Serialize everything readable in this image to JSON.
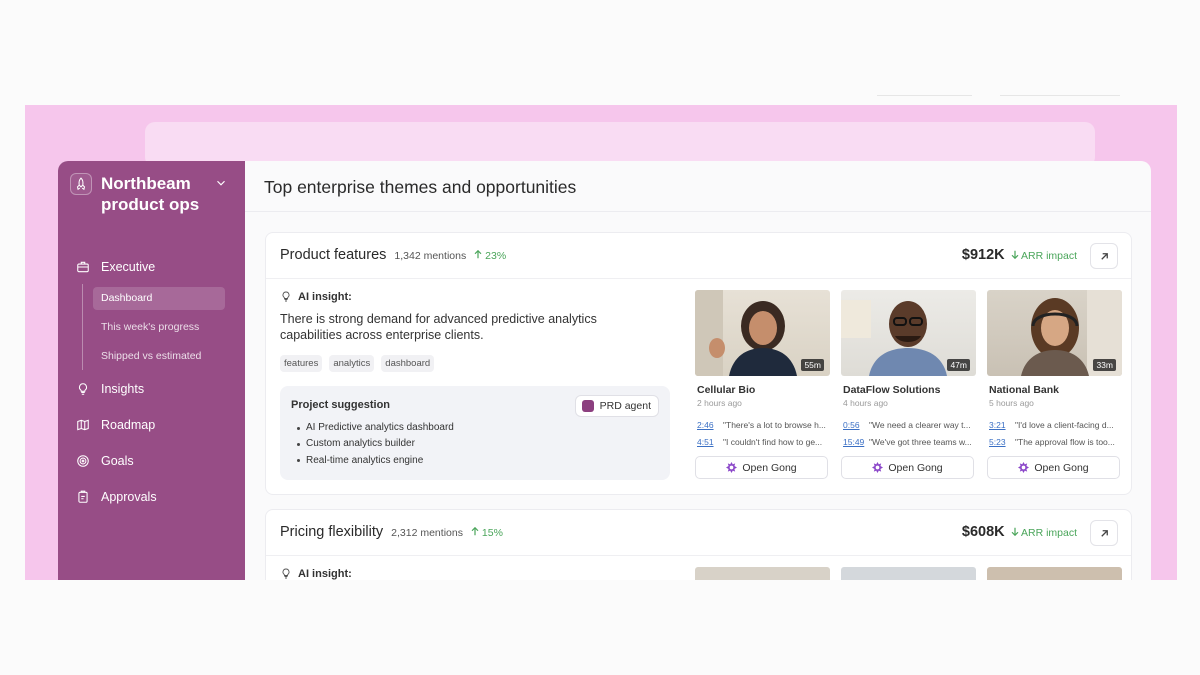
{
  "app": {
    "brand_name": "Northbeam product ops",
    "page_title": "Top enterprise themes and opportunities"
  },
  "sidebar": {
    "items": [
      {
        "label": "Executive",
        "icon": "briefcase-icon"
      },
      {
        "label": "Insights",
        "icon": "lightbulb-icon"
      },
      {
        "label": "Roadmap",
        "icon": "map-icon"
      },
      {
        "label": "Goals",
        "icon": "target-icon"
      },
      {
        "label": "Approvals",
        "icon": "clipboard-icon"
      }
    ],
    "subitems": [
      {
        "label": "Dashboard",
        "active": true
      },
      {
        "label": "This week's progress",
        "active": false
      },
      {
        "label": "Shipped vs estimated",
        "active": false
      }
    ]
  },
  "themes": [
    {
      "title": "Product features",
      "mentions": "1,342 mentions",
      "growth": "23%",
      "arr_value": "$912K",
      "arr_label": "ARR impact",
      "insight_label": "AI insight:",
      "insight_text": "There is strong demand for advanced predictive analytics capabilities across enterprise clients.",
      "tags": [
        "features",
        "analytics",
        "dashboard"
      ],
      "project": {
        "title": "Project suggestion",
        "agent_label": "PRD agent",
        "items": [
          "AI Predictive analytics dashboard",
          "Custom analytics builder",
          "Real-time analytics engine"
        ]
      },
      "calls": [
        {
          "company": "Cellular Bio",
          "ago": "2 hours ago",
          "duration": "55m",
          "quotes": [
            {
              "ts": "2:46",
              "text": "\"There's a lot to browse h..."
            },
            {
              "ts": "4:51",
              "text": "\"I couldn't find how to ge..."
            }
          ],
          "button": "Open Gong"
        },
        {
          "company": "DataFlow Solutions",
          "ago": "4 hours ago",
          "duration": "47m",
          "quotes": [
            {
              "ts": "0:56",
              "text": "\"We need a clearer way t..."
            },
            {
              "ts": "15:49",
              "text": "\"We've got three teams w..."
            }
          ],
          "button": "Open Gong"
        },
        {
          "company": "National Bank",
          "ago": "5 hours ago",
          "duration": "33m",
          "quotes": [
            {
              "ts": "3:21",
              "text": "\"I'd love a client-facing d..."
            },
            {
              "ts": "5:23",
              "text": "\"The approval flow is too..."
            }
          ],
          "button": "Open Gong"
        }
      ]
    },
    {
      "title": "Pricing flexibility",
      "mentions": "2,312 mentions",
      "growth": "15%",
      "arr_value": "$608K",
      "arr_label": "ARR impact",
      "insight_label": "AI insight:"
    }
  ],
  "colors": {
    "sidebar": "#974d86",
    "pink_band": "#f6c6ec",
    "positive": "#4aa55a",
    "link": "#3a6fc4"
  }
}
